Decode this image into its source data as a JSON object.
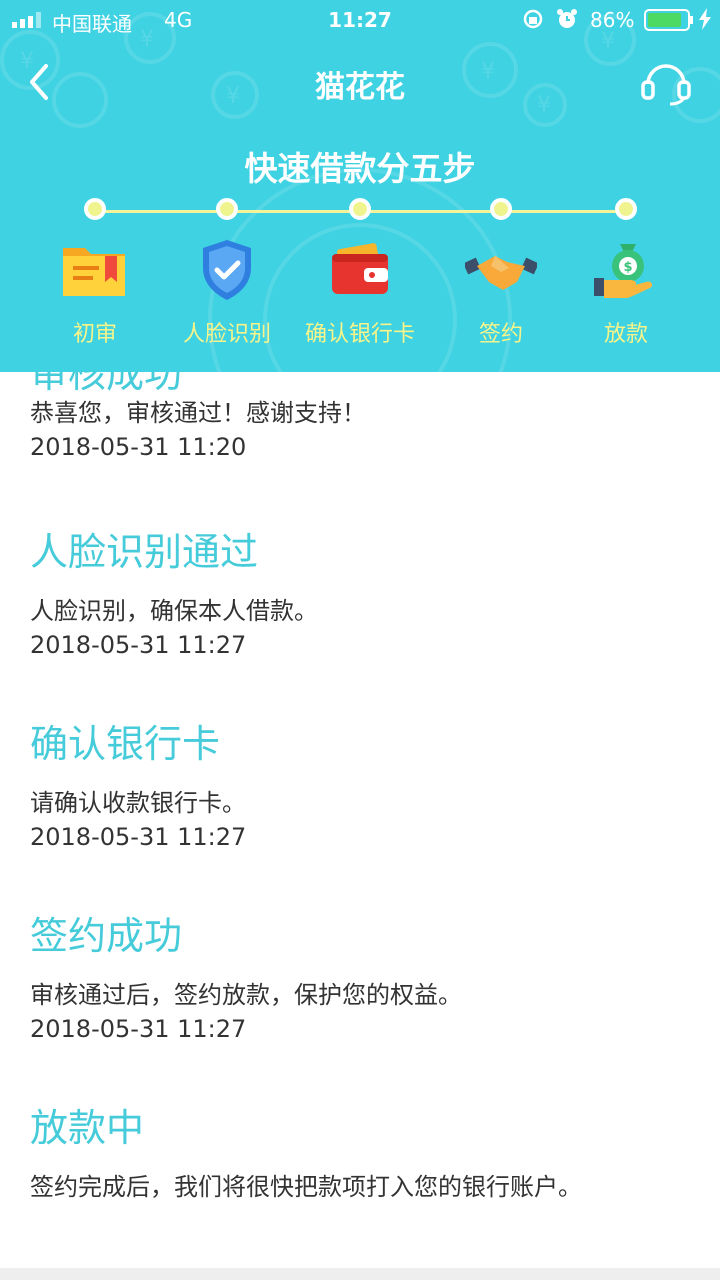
{
  "status_bar": {
    "carrier": "中国联通",
    "network": "4G",
    "time": "11:27",
    "battery_percent": "86%",
    "battery_level": 0.86
  },
  "nav": {
    "title": "猫花花",
    "back_icon": "chevron-left-icon",
    "service_icon": "headset-icon"
  },
  "steps": {
    "title": "快速借款分五步",
    "items": [
      {
        "label": "初审",
        "icon": "folder-icon"
      },
      {
        "label": "人脸识别",
        "icon": "shield-check-icon"
      },
      {
        "label": "确认银行卡",
        "icon": "wallet-icon"
      },
      {
        "label": "签约",
        "icon": "handshake-icon"
      },
      {
        "label": "放款",
        "icon": "money-bag-icon"
      }
    ]
  },
  "timeline": [
    {
      "title": "审核成功",
      "desc": "恭喜您，审核通过！感谢支持！",
      "time": "2018-05-31 11:20"
    },
    {
      "title": "人脸识别通过",
      "desc": "人脸识别，确保本人借款。",
      "time": "2018-05-31 11:27"
    },
    {
      "title": "确认银行卡",
      "desc": "请确认收款银行卡。",
      "time": "2018-05-31 11:27"
    },
    {
      "title": "签约成功",
      "desc": "审核通过后，签约放款，保护您的权益。",
      "time": "2018-05-31 11:27"
    },
    {
      "title": "放款中",
      "desc": "签约完成后，我们将很快把款项打入您的银行账户。",
      "time": ""
    }
  ],
  "colors": {
    "header_bg": "#3fd2e2",
    "step_label": "#f6f48a",
    "title_accent": "#45cbd9"
  }
}
